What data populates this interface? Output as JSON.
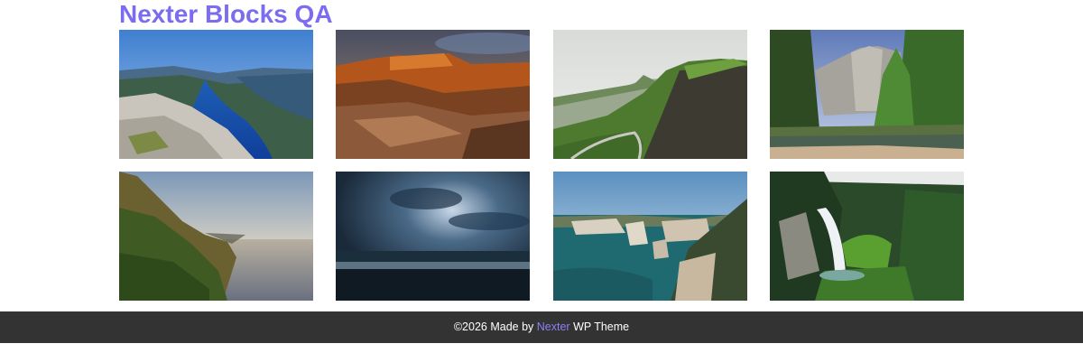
{
  "site": {
    "title": "Nexter Blocks QA",
    "accent_color": "#7b6cf0"
  },
  "gallery": {
    "images": [
      {
        "name": "fjord-cliff-image"
      },
      {
        "name": "red-rock-canyon-image"
      },
      {
        "name": "green-mountain-road-image"
      },
      {
        "name": "yosemite-forest-image"
      },
      {
        "name": "coastal-cliffs-sunset-image"
      },
      {
        "name": "stormy-sea-image"
      },
      {
        "name": "sea-stacks-coast-image"
      },
      {
        "name": "forest-waterfall-image"
      }
    ]
  },
  "footer": {
    "prefix": "©2026 Made by ",
    "brand": "Nexter",
    "suffix": " WP Theme",
    "background": "#333333",
    "brand_color": "#8b7ff5"
  }
}
